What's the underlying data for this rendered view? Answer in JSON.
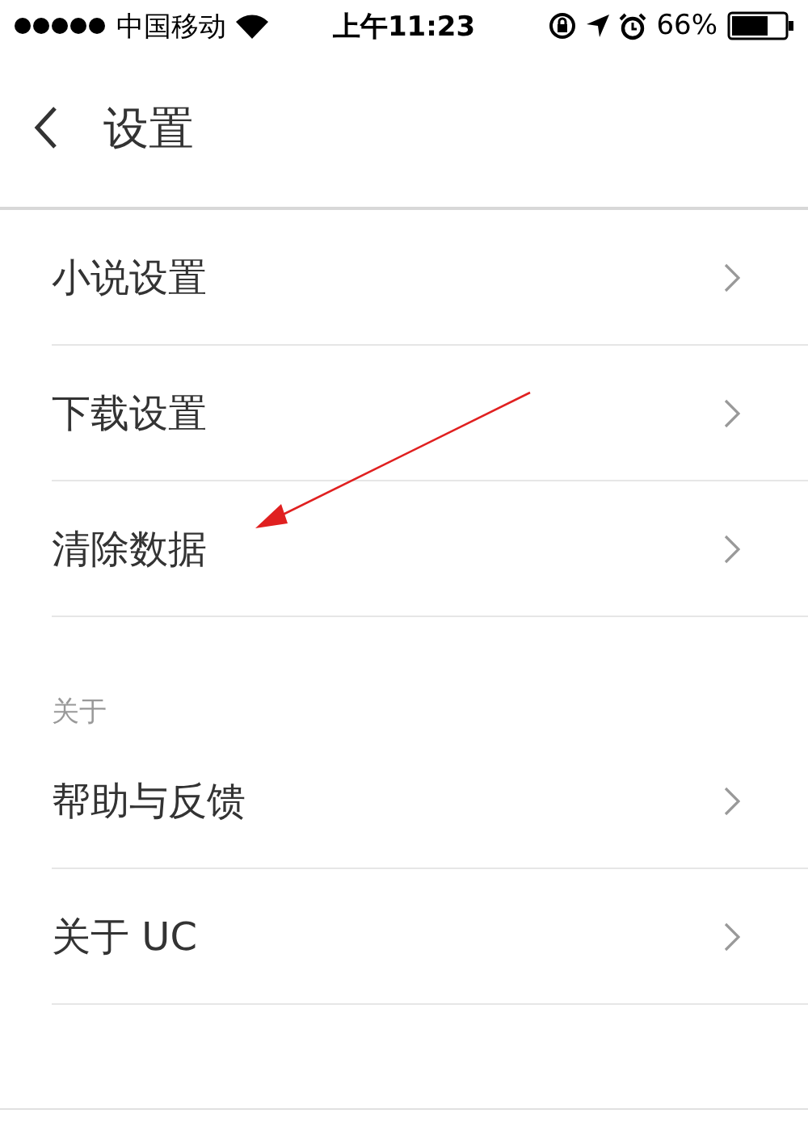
{
  "status_bar": {
    "carrier": "中国移动",
    "time": "上午11:23",
    "battery": "66%"
  },
  "nav": {
    "title": "设置"
  },
  "sections": [
    {
      "items": [
        {
          "label": "小说设置"
        },
        {
          "label": "下载设置"
        },
        {
          "label": "清除数据"
        }
      ]
    },
    {
      "header": "关于",
      "items": [
        {
          "label": "帮助与反馈"
        },
        {
          "label": "关于 UC"
        }
      ]
    }
  ]
}
